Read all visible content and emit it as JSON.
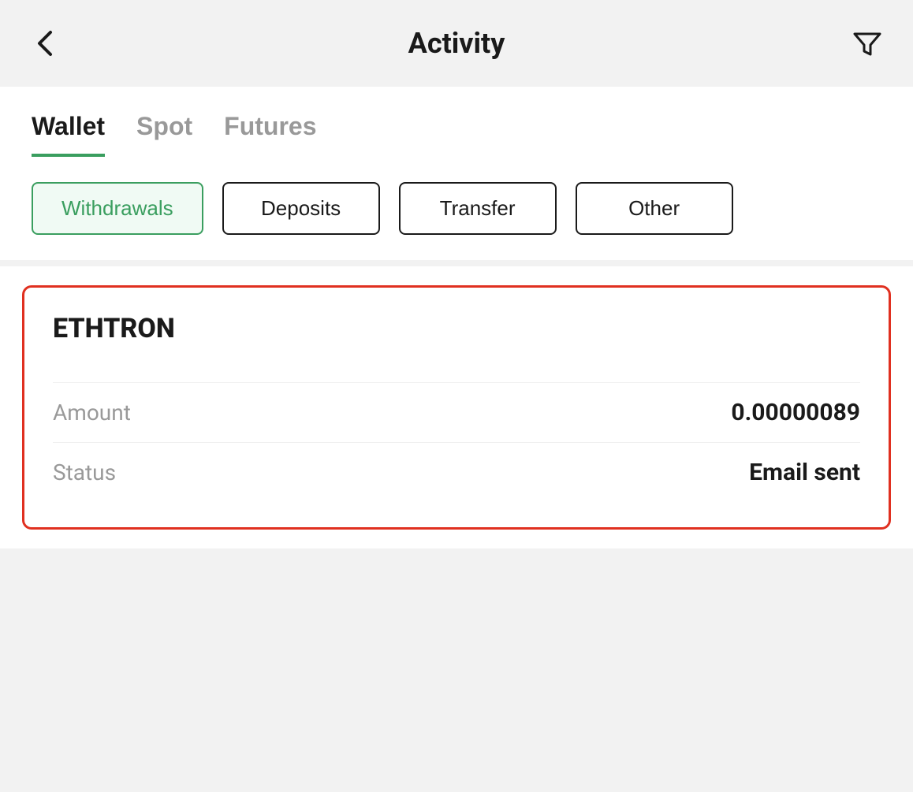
{
  "header": {
    "title": "Activity",
    "back_label": "back",
    "filter_label": "filter"
  },
  "tabs": {
    "items": [
      {
        "label": "Wallet",
        "active": true
      },
      {
        "label": "Spot",
        "active": false
      },
      {
        "label": "Futures",
        "active": false
      }
    ]
  },
  "filter_buttons": [
    {
      "label": "Withdrawals",
      "active": true
    },
    {
      "label": "Deposits",
      "active": false
    },
    {
      "label": "Transfer",
      "active": false
    },
    {
      "label": "Other",
      "active": false
    }
  ],
  "transaction": {
    "title": "ETHTRON",
    "amount_label": "Amount",
    "amount_value": "0.00000089",
    "status_label": "Status",
    "status_value": "Email sent"
  },
  "colors": {
    "accent_green": "#3a9e5f",
    "accent_red": "#e03020",
    "text_dark": "#1a1a1a",
    "text_gray": "#999999"
  }
}
